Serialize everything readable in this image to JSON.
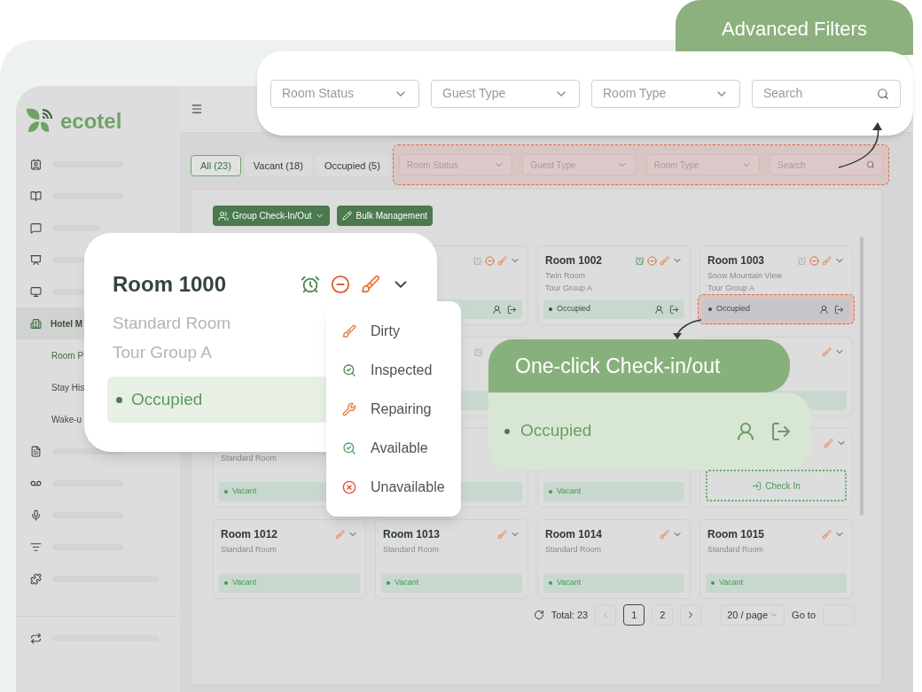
{
  "logo": {
    "text": "ecotel"
  },
  "sidebar": {
    "items": [
      {
        "kind": "placeholder"
      },
      {
        "kind": "placeholder"
      },
      {
        "kind": "placeholder"
      },
      {
        "kind": "placeholder"
      },
      {
        "kind": "placeholder"
      },
      {
        "kind": "label",
        "label": "Hotel M",
        "selected": true,
        "children": [
          {
            "label": "Room P",
            "selected": true
          },
          {
            "label": "Stay His",
            "selected": false
          },
          {
            "label": "Wake-u",
            "selected": false
          }
        ]
      },
      {
        "kind": "placeholder"
      },
      {
        "kind": "placeholder"
      },
      {
        "kind": "placeholder"
      },
      {
        "kind": "placeholder"
      },
      {
        "kind": "placeholder"
      }
    ],
    "footer": {
      "kind": "placeholder"
    }
  },
  "status_tabs": [
    {
      "label": "All (23)",
      "selected": true
    },
    {
      "label": "Vacant (18)",
      "selected": false
    },
    {
      "label": "Occupied (5)",
      "selected": false
    }
  ],
  "filters": [
    {
      "kind": "select",
      "placeholder": "Room Status"
    },
    {
      "kind": "select",
      "placeholder": "Guest Type"
    },
    {
      "kind": "select",
      "placeholder": "Room Type"
    },
    {
      "kind": "search",
      "placeholder": "Search"
    }
  ],
  "actions": [
    {
      "kind": "group",
      "label": "Group Check-In/Out"
    },
    {
      "kind": "edit",
      "label": "Bulk Management"
    }
  ],
  "rooms": [
    {
      "kind": "blank"
    },
    {
      "kind": "room",
      "alarm_set": false,
      "blocked": true,
      "dirty": true,
      "status_bar": true,
      "guest_actions": true
    },
    {
      "kind": "room",
      "title": "Room 1002",
      "lines": [
        "Twin Room",
        "Tour Group A"
      ],
      "alarm_set": true,
      "blocked": true,
      "dirty": true,
      "status": "Occupied",
      "status_bar": true,
      "guest_actions": true
    },
    {
      "kind": "room",
      "title": "Room 1003",
      "lines": [
        "Snow Mountain View",
        "Tour Group A"
      ],
      "alarm_set": false,
      "blocked": true,
      "dirty": true,
      "status": "Occupied",
      "status_bar": true,
      "guest_actions": true,
      "highlighted": true
    },
    {
      "kind": "blank"
    },
    {
      "kind": "room",
      "alarm_set": false,
      "status_bar": true
    },
    {
      "kind": "blank"
    },
    {
      "kind": "room",
      "dirty": true,
      "status_bar": true
    },
    {
      "kind": "room",
      "lines": [
        "Standard Room"
      ],
      "status": "Vacant",
      "status_bar": true
    },
    {
      "kind": "room",
      "status_bar": true
    },
    {
      "kind": "room",
      "status": "Vacant",
      "status_bar": true
    },
    {
      "kind": "checkin",
      "dirty": true,
      "check_in": "Check In"
    },
    {
      "kind": "room",
      "title": "Room 1012",
      "lines": [
        "Standard Room"
      ],
      "dirty": true,
      "status": "Vacant",
      "status_bar": true
    },
    {
      "kind": "room",
      "title": "Room 1013",
      "lines": [
        "Standard Room"
      ],
      "dirty": true,
      "status": "Vacant",
      "status_bar": true
    },
    {
      "kind": "room",
      "title": "Room 1014",
      "lines": [
        "Standard Room"
      ],
      "dirty": true,
      "status": "Vacant",
      "status_bar": true
    },
    {
      "kind": "room",
      "title": "Room 1015",
      "lines": [
        "Standard Room"
      ],
      "dirty": true,
      "status": "Vacant",
      "status_bar": true
    }
  ],
  "pagination": {
    "total": "Total: 23",
    "pages": [
      {
        "label": "1",
        "selected": true
      },
      {
        "label": "2",
        "selected": false
      }
    ],
    "page_size": "20 / page",
    "goto_label": "Go to"
  },
  "room_popup": {
    "title": "Room 1000",
    "lines": [
      "Standard Room",
      "Tour Group A"
    ],
    "alarm_set": true,
    "blocked": true,
    "dirty": true,
    "status": "Occupied"
  },
  "status_menu": {
    "items": [
      {
        "kind": "dirty",
        "label": "Dirty"
      },
      {
        "kind": "inspected",
        "label": "Inspected"
      },
      {
        "kind": "repair",
        "label": "Repairing"
      },
      {
        "kind": "available",
        "label": "Available"
      },
      {
        "kind": "unavailable",
        "label": "Unavailable"
      }
    ]
  },
  "checkin_callout": {
    "title": "One-click Check-in/out",
    "status": "Occupied"
  },
  "filters_callout": {
    "title": "Advanced Filters",
    "filters": [
      {
        "kind": "select",
        "placeholder": "Room Status"
      },
      {
        "kind": "select",
        "placeholder": "Guest Type"
      },
      {
        "kind": "select",
        "placeholder": "Room Type"
      },
      {
        "kind": "search",
        "placeholder": "Search"
      }
    ]
  }
}
